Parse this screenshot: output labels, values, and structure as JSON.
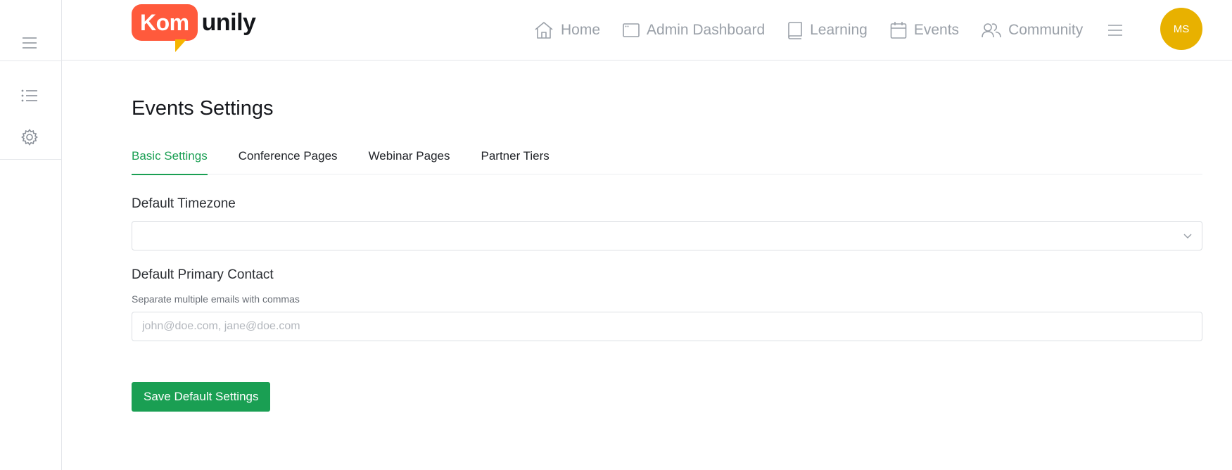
{
  "brand": {
    "logo_part1": "Kom",
    "logo_part2": "unily",
    "colors": {
      "bubble": "#ff5a3c",
      "tail": "#f5b400"
    }
  },
  "sidebar": {
    "items": [
      {
        "icon": "hamburger-menu-icon"
      },
      {
        "icon": "list-icon"
      },
      {
        "icon": "gear-icon"
      }
    ]
  },
  "nav": {
    "items": [
      {
        "label": "Home",
        "icon": "home-icon"
      },
      {
        "label": "Admin Dashboard",
        "icon": "dashboard-window-icon"
      },
      {
        "label": "Learning",
        "icon": "book-icon"
      },
      {
        "label": "Events",
        "icon": "calendar-icon"
      },
      {
        "label": "Community",
        "icon": "users-icon"
      }
    ],
    "menu_icon": "hamburger-menu-icon",
    "avatar_initials": "MS",
    "avatar_color": "#e8b100"
  },
  "page": {
    "title": "Events Settings",
    "tabs": [
      {
        "label": "Basic Settings",
        "active": true
      },
      {
        "label": "Conference Pages",
        "active": false
      },
      {
        "label": "Webinar Pages",
        "active": false
      },
      {
        "label": "Partner Tiers",
        "active": false
      }
    ],
    "timezone": {
      "label": "Default Timezone",
      "value": ""
    },
    "contact": {
      "label": "Default Primary Contact",
      "help": "Separate multiple emails with commas",
      "placeholder": "john@doe.com, jane@doe.com",
      "value": ""
    },
    "save_label": "Save Default Settings",
    "accent": "#1a9f53"
  }
}
